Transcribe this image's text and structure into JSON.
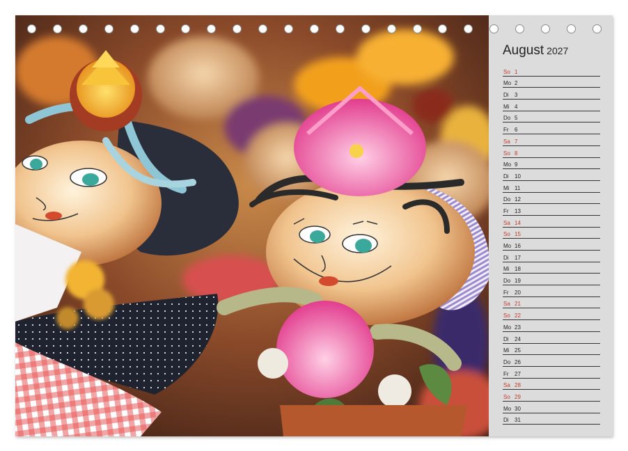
{
  "calendar": {
    "month": "August",
    "year": "2027",
    "days": [
      {
        "wd": "So",
        "n": "1",
        "weekend": true
      },
      {
        "wd": "Mo",
        "n": "2",
        "weekend": false
      },
      {
        "wd": "Di",
        "n": "3",
        "weekend": false
      },
      {
        "wd": "Mi",
        "n": "4",
        "weekend": false
      },
      {
        "wd": "Do",
        "n": "5",
        "weekend": false
      },
      {
        "wd": "Fr",
        "n": "6",
        "weekend": false
      },
      {
        "wd": "Sa",
        "n": "7",
        "weekend": true
      },
      {
        "wd": "So",
        "n": "8",
        "weekend": true
      },
      {
        "wd": "Mo",
        "n": "9",
        "weekend": false
      },
      {
        "wd": "Di",
        "n": "10",
        "weekend": false
      },
      {
        "wd": "Mi",
        "n": "11",
        "weekend": false
      },
      {
        "wd": "Do",
        "n": "12",
        "weekend": false
      },
      {
        "wd": "Fr",
        "n": "13",
        "weekend": false
      },
      {
        "wd": "Sa",
        "n": "14",
        "weekend": true
      },
      {
        "wd": "So",
        "n": "15",
        "weekend": true
      },
      {
        "wd": "Mo",
        "n": "16",
        "weekend": false
      },
      {
        "wd": "Di",
        "n": "17",
        "weekend": false
      },
      {
        "wd": "Mi",
        "n": "18",
        "weekend": false
      },
      {
        "wd": "Do",
        "n": "19",
        "weekend": false
      },
      {
        "wd": "Fr",
        "n": "20",
        "weekend": false
      },
      {
        "wd": "Sa",
        "n": "21",
        "weekend": true
      },
      {
        "wd": "So",
        "n": "22",
        "weekend": true
      },
      {
        "wd": "Mo",
        "n": "23",
        "weekend": false
      },
      {
        "wd": "Di",
        "n": "24",
        "weekend": false
      },
      {
        "wd": "Mi",
        "n": "25",
        "weekend": false
      },
      {
        "wd": "Do",
        "n": "26",
        "weekend": false
      },
      {
        "wd": "Fr",
        "n": "27",
        "weekend": false
      },
      {
        "wd": "Sa",
        "n": "28",
        "weekend": true
      },
      {
        "wd": "So",
        "n": "29",
        "weekend": true
      },
      {
        "wd": "Mo",
        "n": "30",
        "weekend": false
      },
      {
        "wd": "Di",
        "n": "31",
        "weekend": false
      }
    ],
    "weekend_color": "#c0392b",
    "panel_color": "#dcdcdc",
    "ring_count": 23
  },
  "photo": {
    "subject": "onion dolls with dried flowers"
  }
}
